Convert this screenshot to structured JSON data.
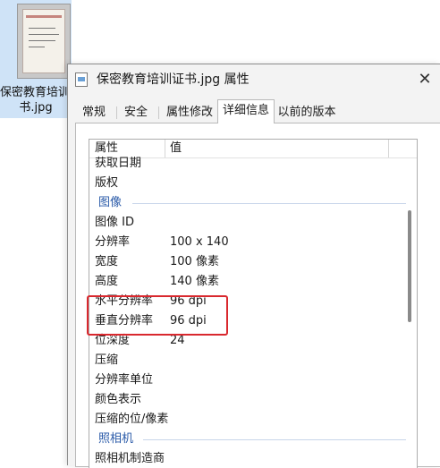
{
  "desktop": {
    "file_name_line1": "保密教育培训证",
    "file_name_line2": "书.jpg"
  },
  "dialog": {
    "title": "保密教育培训证书.jpg 属性",
    "close_glyph": "✕",
    "tabs": [
      {
        "label": "常规",
        "active": false
      },
      {
        "label": "安全",
        "active": false
      },
      {
        "label": "属性修改",
        "active": false
      },
      {
        "label": "详细信息",
        "active": true
      },
      {
        "label": "以前的版本",
        "active": false
      }
    ],
    "list": {
      "header_name": "属性",
      "header_value": "值",
      "rows": [
        {
          "name": "获取日期",
          "value": ""
        },
        {
          "name": "版权",
          "value": ""
        },
        {
          "group": "图像"
        },
        {
          "name": "图像 ID",
          "value": ""
        },
        {
          "name": "分辨率",
          "value": "100 x 140"
        },
        {
          "name": "宽度",
          "value": "100 像素"
        },
        {
          "name": "高度",
          "value": "140 像素"
        },
        {
          "name": "水平分辨率",
          "value": "96 dpi",
          "highlighted": true
        },
        {
          "name": "垂直分辨率",
          "value": "96 dpi",
          "highlighted": true
        },
        {
          "name": "位深度",
          "value": "24"
        },
        {
          "name": "压缩",
          "value": ""
        },
        {
          "name": "分辨率单位",
          "value": ""
        },
        {
          "name": "颜色表示",
          "value": ""
        },
        {
          "name": "压缩的位/像素",
          "value": ""
        },
        {
          "group": "照相机"
        },
        {
          "name": "照相机制造商",
          "value": ""
        }
      ]
    }
  },
  "colors": {
    "highlight_border": "#d9282e",
    "group_label": "#2a5aa8",
    "selection_bg": "#cfe3f7"
  },
  "icons": {
    "title_icon": "image-file-icon",
    "close": "close-icon"
  }
}
